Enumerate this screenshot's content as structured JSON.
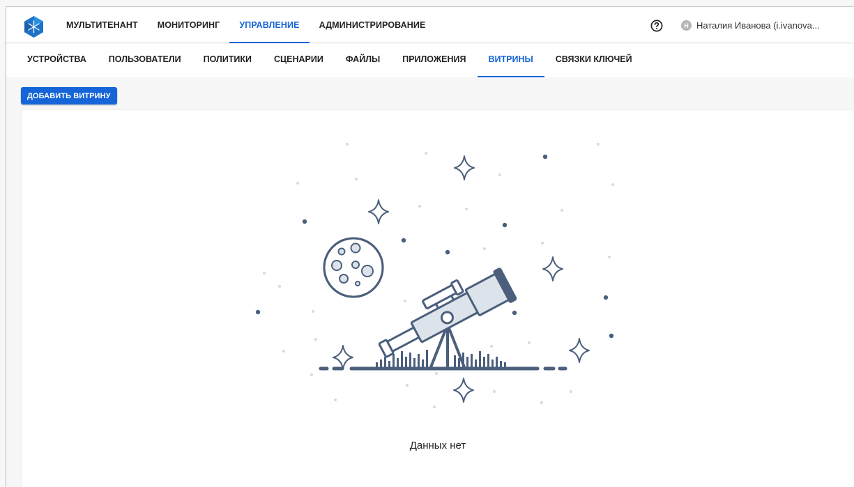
{
  "header": {
    "nav": [
      {
        "label": "МУЛЬТИТЕНАНТ",
        "active": false
      },
      {
        "label": "МОНИТОРИНГ",
        "active": false
      },
      {
        "label": "УПРАВЛЕНИЕ",
        "active": true
      },
      {
        "label": "АДМИНИСТРИРОВАНИЕ",
        "active": false
      }
    ],
    "help_icon": "question-circle-icon",
    "avatar_initial": "Н",
    "user_name": "Наталия Иванова (i.ivanova..."
  },
  "subnav": [
    {
      "label": "УСТРОЙСТВА",
      "active": false
    },
    {
      "label": "ПОЛЬЗОВАТЕЛИ",
      "active": false
    },
    {
      "label": "ПОЛИТИКИ",
      "active": false
    },
    {
      "label": "СЦЕНАРИИ",
      "active": false
    },
    {
      "label": "ФАЙЛЫ",
      "active": false
    },
    {
      "label": "ПРИЛОЖЕНИЯ",
      "active": false
    },
    {
      "label": "ВИТРИНЫ",
      "active": true
    },
    {
      "label": "СВЯЗКИ КЛЮЧЕЙ",
      "active": false
    }
  ],
  "toolbar": {
    "add_label": "ДОБАВИТЬ ВИТРИНУ"
  },
  "empty_state": {
    "text": "Данных нет",
    "illustration": "telescope-night-sky"
  },
  "colors": {
    "accent": "#1565d8",
    "illustration": "#4b5f7c",
    "illustration_fill": "#dde3ea"
  }
}
